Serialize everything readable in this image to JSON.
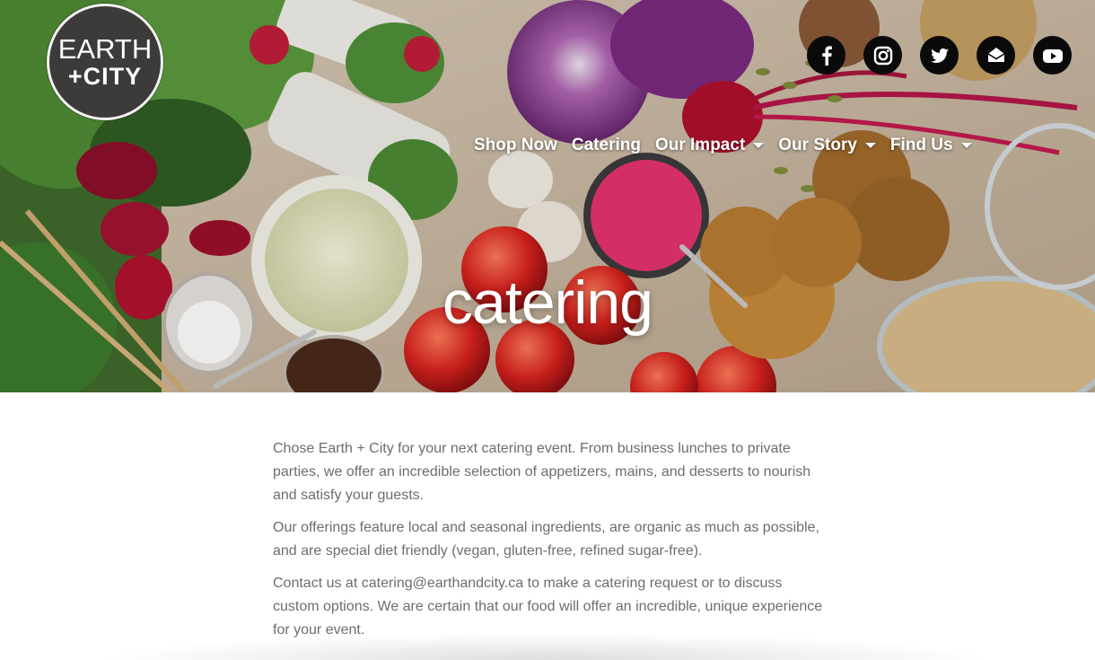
{
  "brand": {
    "logo_line1": "EARTH",
    "logo_line2": "+CITY"
  },
  "social": [
    {
      "name": "facebook-icon"
    },
    {
      "name": "instagram-icon"
    },
    {
      "name": "twitter-icon"
    },
    {
      "name": "email-icon"
    },
    {
      "name": "youtube-icon"
    }
  ],
  "nav": {
    "items": [
      {
        "label": "Shop Now",
        "has_dropdown": false
      },
      {
        "label": "Catering",
        "has_dropdown": false
      },
      {
        "label": "Our Impact",
        "has_dropdown": true
      },
      {
        "label": "Our Story",
        "has_dropdown": true
      },
      {
        "label": "Find Us",
        "has_dropdown": true
      }
    ]
  },
  "hero": {
    "title": "catering"
  },
  "content": {
    "paragraphs": [
      "Chose Earth + City for your next catering event. From business lunches to private parties, we offer an incredible selection of appetizers, mains, and desserts to nourish and satisfy your guests.",
      "Our offerings feature local and seasonal ingredients, are organic as much as possible, and are special diet friendly (vegan, gluten-free, refined sugar-free).",
      "Contact us at catering@earthandcity.ca to make a catering request or to discuss custom options. We are certain that our food will offer an incredible, unique experience for your event."
    ]
  },
  "colors": {
    "logo_bg": "#3d3a3a",
    "social_bg": "#0a0a0a",
    "body_text": "#6d6d6d",
    "nav_text": "#ffffff",
    "beet": "#e0336e"
  }
}
